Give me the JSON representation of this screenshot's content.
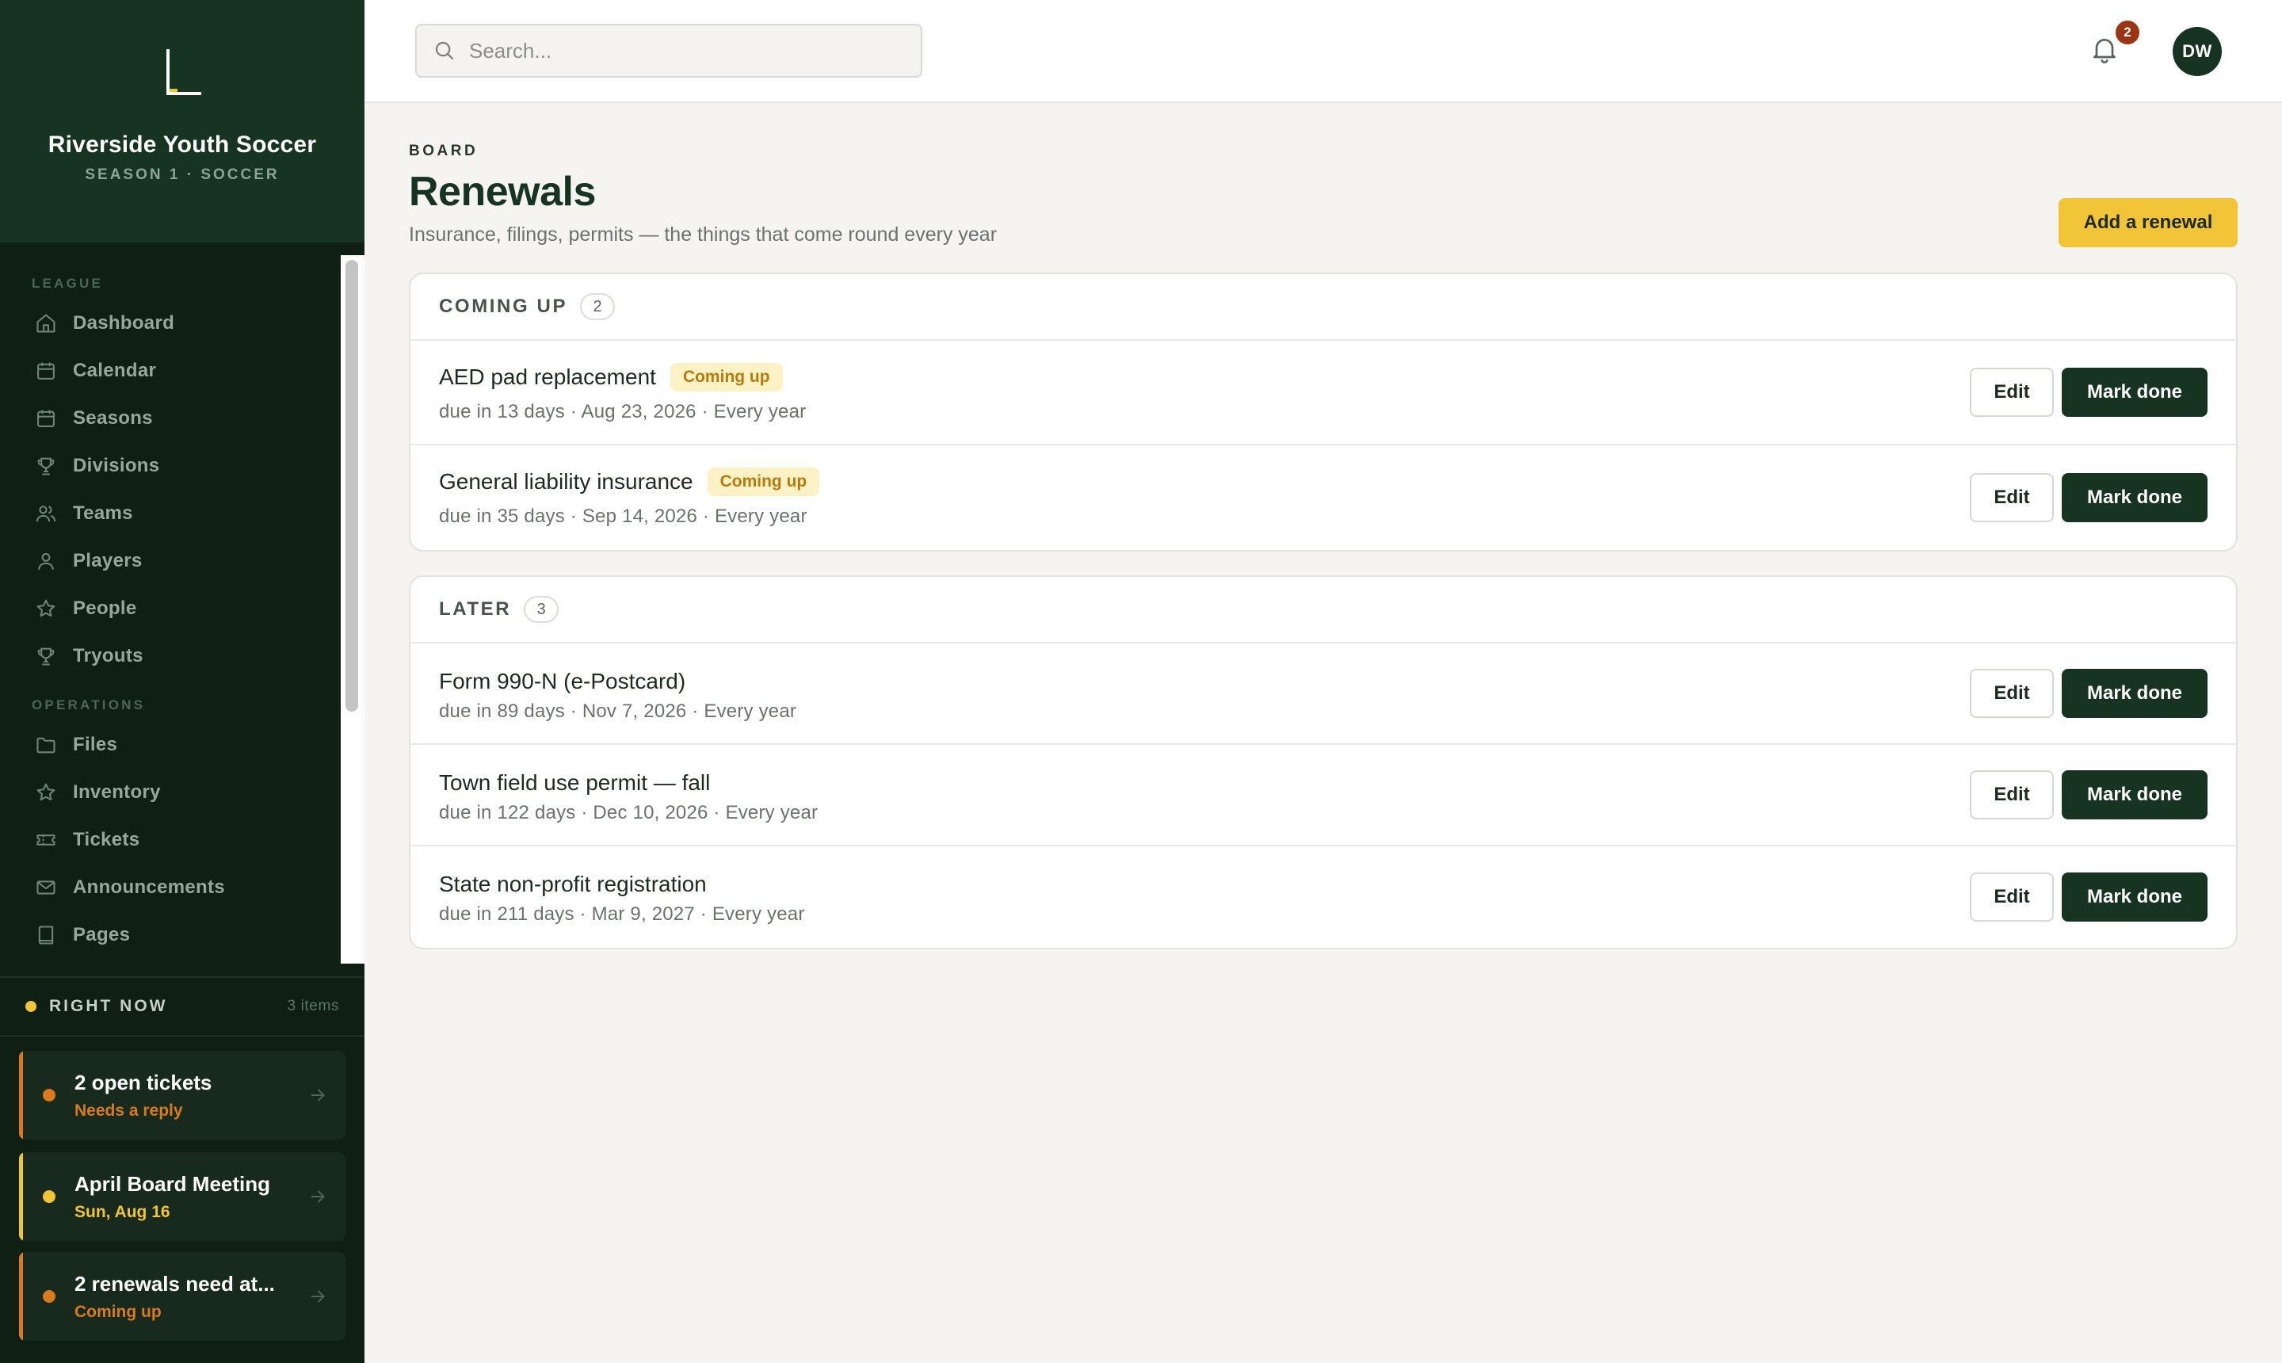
{
  "brand": {
    "name": "Riverside Youth Soccer",
    "subtitle": "SEASON 1 · SOCCER"
  },
  "sidebar": {
    "sections": [
      {
        "label": "LEAGUE",
        "items": [
          {
            "label": "Dashboard",
            "icon": "home-icon"
          },
          {
            "label": "Calendar",
            "icon": "calendar-icon"
          },
          {
            "label": "Seasons",
            "icon": "calendar-icon"
          },
          {
            "label": "Divisions",
            "icon": "trophy-icon"
          },
          {
            "label": "Teams",
            "icon": "users-icon"
          },
          {
            "label": "Players",
            "icon": "user-icon"
          },
          {
            "label": "People",
            "icon": "star-icon"
          },
          {
            "label": "Tryouts",
            "icon": "trophy-icon"
          }
        ]
      },
      {
        "label": "OPERATIONS",
        "items": [
          {
            "label": "Files",
            "icon": "folder-icon"
          },
          {
            "label": "Inventory",
            "icon": "star-icon"
          },
          {
            "label": "Tickets",
            "icon": "ticket-icon"
          },
          {
            "label": "Announcements",
            "icon": "mail-icon"
          },
          {
            "label": "Pages",
            "icon": "book-icon"
          }
        ]
      }
    ]
  },
  "right_now": {
    "title": "RIGHT NOW",
    "count": "3 items",
    "cards": [
      {
        "title": "2 open tickets",
        "subtitle": "Needs a reply",
        "color": "#d97a1c"
      },
      {
        "title": "April Board Meeting",
        "subtitle": "Sun, Aug 16",
        "color": "#f2c438"
      },
      {
        "title": "2 renewals need at...",
        "subtitle": "Coming up",
        "color": "#d97a1c"
      }
    ]
  },
  "topbar": {
    "search_placeholder": "Search...",
    "notification_count": "2",
    "avatar_initials": "DW"
  },
  "page": {
    "eyebrow": "BOARD",
    "title": "Renewals",
    "subtitle": "Insurance, filings, permits — the things that come round every year",
    "add_button": "Add a renewal"
  },
  "groups": [
    {
      "label": "COMING UP",
      "count": "2",
      "rows": [
        {
          "title": "AED pad replacement",
          "tag": "Coming up",
          "meta": "due in 13 days · Aug 23, 2026 · Every year"
        },
        {
          "title": "General liability insurance",
          "tag": "Coming up",
          "meta": "due in 35 days · Sep 14, 2026 · Every year"
        }
      ]
    },
    {
      "label": "LATER",
      "count": "3",
      "rows": [
        {
          "title": "Form 990-N (e-Postcard)",
          "tag": "",
          "meta": "due in 89 days · Nov 7, 2026 · Every year"
        },
        {
          "title": "Town field use permit — fall",
          "tag": "",
          "meta": "due in 122 days · Dec 10, 2026 · Every year"
        },
        {
          "title": "State non-profit registration",
          "tag": "",
          "meta": "due in 211 days · Mar 9, 2027 · Every year"
        }
      ]
    }
  ],
  "row_actions": {
    "edit": "Edit",
    "done": "Mark done"
  },
  "colors": {
    "sidebar_bg": "#0f1f14",
    "brand_bg": "#173322",
    "accent_yellow": "#f2c438",
    "accent_orange": "#d97a1c",
    "primary_green": "#173322"
  }
}
